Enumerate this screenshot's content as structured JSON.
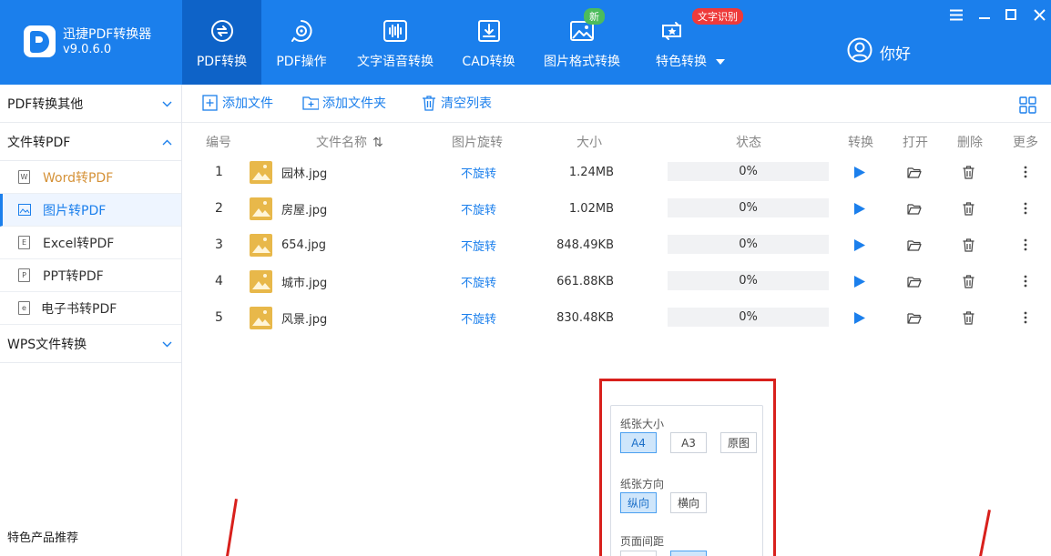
{
  "app": {
    "name": "迅捷PDF转换器",
    "version": "v9.0.6.0"
  },
  "nav": {
    "tabs": [
      {
        "label": "PDF转换",
        "icon": "refresh-circle-icon",
        "active": true
      },
      {
        "label": "PDF操作",
        "icon": "gear-doc-icon"
      },
      {
        "label": "文字语音转换",
        "icon": "audio-wave-icon"
      },
      {
        "label": "CAD转换",
        "icon": "cad-import-icon"
      },
      {
        "label": "图片格式转换",
        "icon": "image-icon",
        "badge": "新"
      },
      {
        "label": "特色转换",
        "icon": "star-box-icon",
        "badge": "文字识别"
      }
    ]
  },
  "user": {
    "label": "你好"
  },
  "sidebar": {
    "groups": [
      {
        "label": "PDF转换其他",
        "expanded": false
      },
      {
        "label": "文件转PDF",
        "expanded": true
      },
      {
        "label": "WPS文件转换",
        "expanded": false
      }
    ],
    "items": [
      {
        "label": "Word转PDF",
        "icon_letter": "W"
      },
      {
        "label": "图片转PDF",
        "active": true
      },
      {
        "label": "Excel转PDF",
        "icon_letter": "E"
      },
      {
        "label": "PPT转PDF",
        "icon_letter": "P"
      },
      {
        "label": "电子书转PDF",
        "icon_letter": "e"
      }
    ],
    "footer": "特色产品推荐"
  },
  "toolbar": {
    "add_file": "添加文件",
    "add_folder": "添加文件夹",
    "clear_list": "清空列表"
  },
  "table": {
    "headers": {
      "num": "编号",
      "name": "文件名称",
      "rotate": "图片旋转",
      "size": "大小",
      "status": "状态",
      "convert": "转换",
      "open": "打开",
      "delete": "删除",
      "more": "更多"
    },
    "rows": [
      {
        "num": "1",
        "name": "园林.jpg",
        "rotate": "不旋转",
        "size": "1.24MB",
        "progress": "0%"
      },
      {
        "num": "2",
        "name": "房屋.jpg",
        "rotate": "不旋转",
        "size": "1.02MB",
        "progress": "0%"
      },
      {
        "num": "3",
        "name": "654.jpg",
        "rotate": "不旋转",
        "size": "848.49KB",
        "progress": "0%"
      },
      {
        "num": "4",
        "name": "城市.jpg",
        "rotate": "不旋转",
        "size": "661.88KB",
        "progress": "0%"
      },
      {
        "num": "5",
        "name": "风景.jpg",
        "rotate": "不旋转",
        "size": "830.48KB",
        "progress": "0%"
      }
    ]
  },
  "settings": {
    "paper_size_label": "纸张大小",
    "paper_sizes": [
      "A4",
      "A3",
      "原图"
    ],
    "paper_size_selected": "A4",
    "orientation_label": "纸张方向",
    "orientations": [
      "纵向",
      "横向"
    ],
    "orientation_selected": "纵向",
    "margin_label": "页面间距"
  },
  "colors": {
    "header_blue": "#1b7fec",
    "active_tab": "#0e63c8",
    "highlight_red": "#d8201c",
    "word_orange": "#d59238"
  }
}
